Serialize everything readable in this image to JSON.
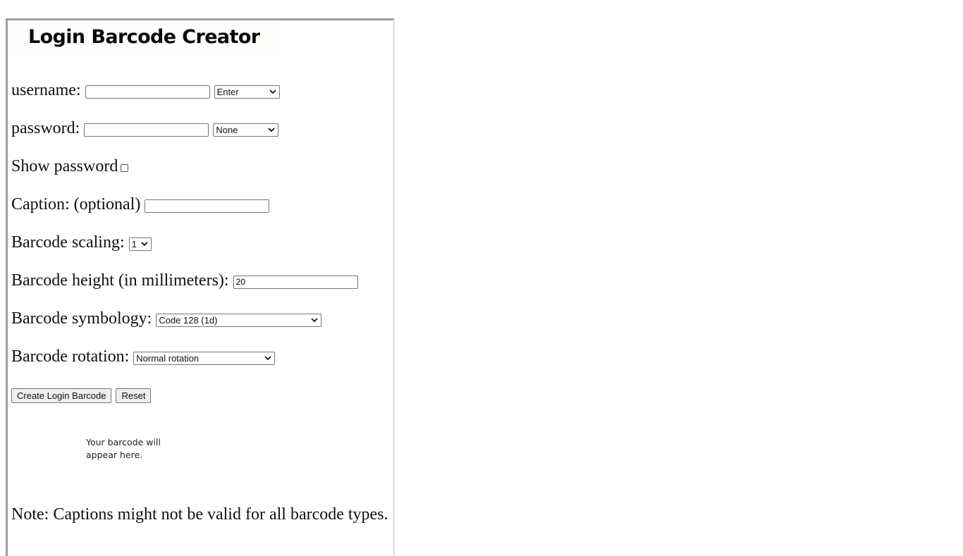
{
  "header": {
    "title": "Login Barcode Creator"
  },
  "form": {
    "username": {
      "label": "username:",
      "value": "",
      "suffix_select": "Enter"
    },
    "password": {
      "label": "password:",
      "value": "",
      "suffix_select": "None"
    },
    "show_password": {
      "label": "Show password",
      "checked": false
    },
    "caption": {
      "label": "Caption: (optional)",
      "value": ""
    },
    "scaling": {
      "label": "Barcode scaling:",
      "selected": "1"
    },
    "height": {
      "label": "Barcode height (in millimeters):",
      "value": "20"
    },
    "symbology": {
      "label": "Barcode symbology:",
      "selected": "Code 128 (1d)"
    },
    "rotation": {
      "label": "Barcode rotation:",
      "selected": "Normal rotation"
    },
    "buttons": {
      "create": "Create Login Barcode",
      "reset": "Reset"
    }
  },
  "output": {
    "placeholder": "Your barcode will appear here."
  },
  "note": "Note: Captions might not be valid for all barcode types."
}
